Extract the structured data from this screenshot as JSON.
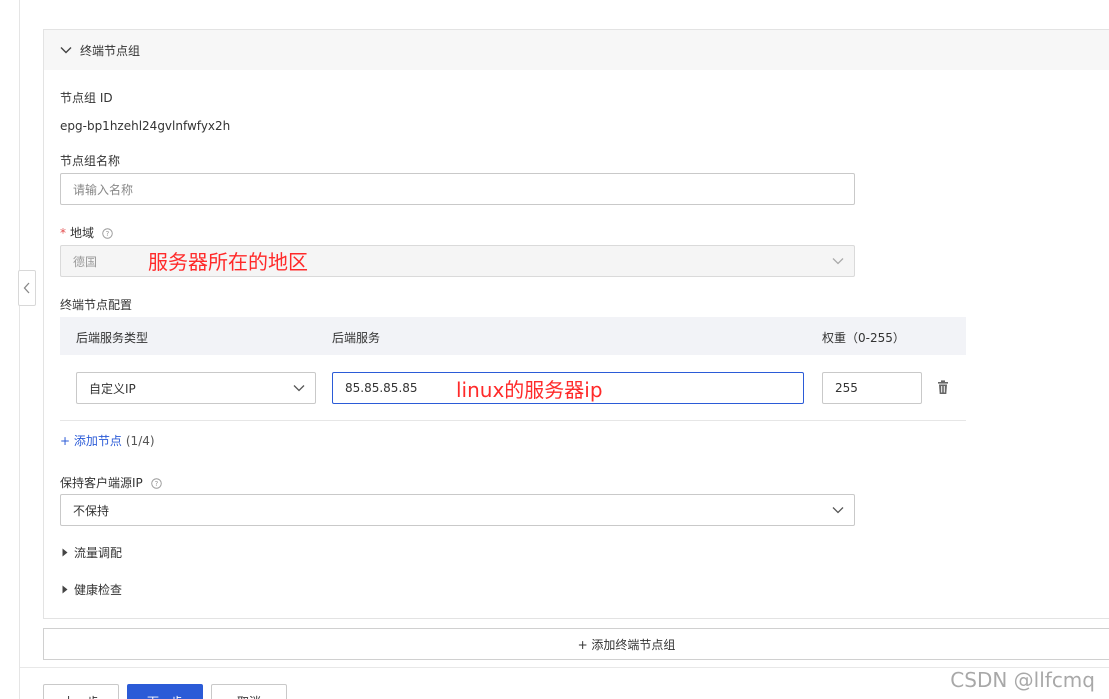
{
  "panel": {
    "title": "终端节点组"
  },
  "fields": {
    "group_id_label": "节点组 ID",
    "group_id_value": "epg-bp1hzehl24gvlnfwfyx2h",
    "group_name_label": "节点组名称",
    "group_name_placeholder": "请输入名称",
    "region_label": "地域",
    "region_value": "德国",
    "endpoint_config_label": "终端节点配置",
    "client_ip_label": "保持客户端源IP",
    "client_ip_value": "不保持"
  },
  "table": {
    "headers": [
      "后端服务类型",
      "后端服务",
      "权重（0-255）"
    ],
    "rows": [
      {
        "type": "自定义IP",
        "service": "85.85.85.85",
        "weight": "255"
      }
    ]
  },
  "add_node": {
    "label": "+ 添加节点",
    "count": "(1/4)"
  },
  "sections": {
    "traffic": "流量调配",
    "health": "健康检查"
  },
  "add_group_label": "+ 添加终端节点组",
  "footer": {
    "prev": "上一步",
    "next": "下一步",
    "cancel": "取消"
  },
  "annotations": {
    "region_note": "服务器所在的地区",
    "ip_note": "linux的服务器ip"
  },
  "watermark": "CSDN @llfcmq",
  "colors": {
    "primary": "#2b5bd7",
    "annotation": "#ff2a2a",
    "required": "#e34d4d"
  }
}
